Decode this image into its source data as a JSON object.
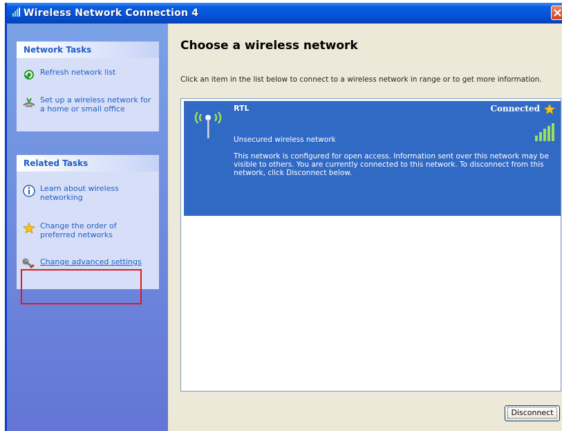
{
  "window": {
    "title": "Wireless Network Connection 4"
  },
  "sidebar": {
    "network_tasks": {
      "header": "Network Tasks",
      "items": [
        {
          "label": "Refresh network list",
          "icon": "refresh-icon"
        },
        {
          "label": "Set up a wireless network for a home or small office",
          "icon": "wireless-setup-icon"
        }
      ]
    },
    "related_tasks": {
      "header": "Related Tasks",
      "items": [
        {
          "label": "Learn about wireless networking",
          "icon": "info-icon"
        },
        {
          "label": "Change the order of preferred networks",
          "icon": "star-icon"
        },
        {
          "label": "Change advanced settings",
          "icon": "settings-icon"
        }
      ]
    }
  },
  "main": {
    "title": "Choose a wireless network",
    "description": "Click an item in the list below to connect to a wireless network in range or to get more information.",
    "networks": [
      {
        "name": "RTL",
        "status": "Connected",
        "security": "Unsecured wireless network",
        "details": "This network is configured for open access. Information sent over this network may be visible to others. You are currently connected to this network. To disconnect from this network, click Disconnect below.",
        "signal": "excellent"
      }
    ],
    "disconnect_label": "Disconnect"
  },
  "colors": {
    "selected": "#316ac5",
    "link": "#215dc6",
    "highlight_border": "#e8141b"
  }
}
